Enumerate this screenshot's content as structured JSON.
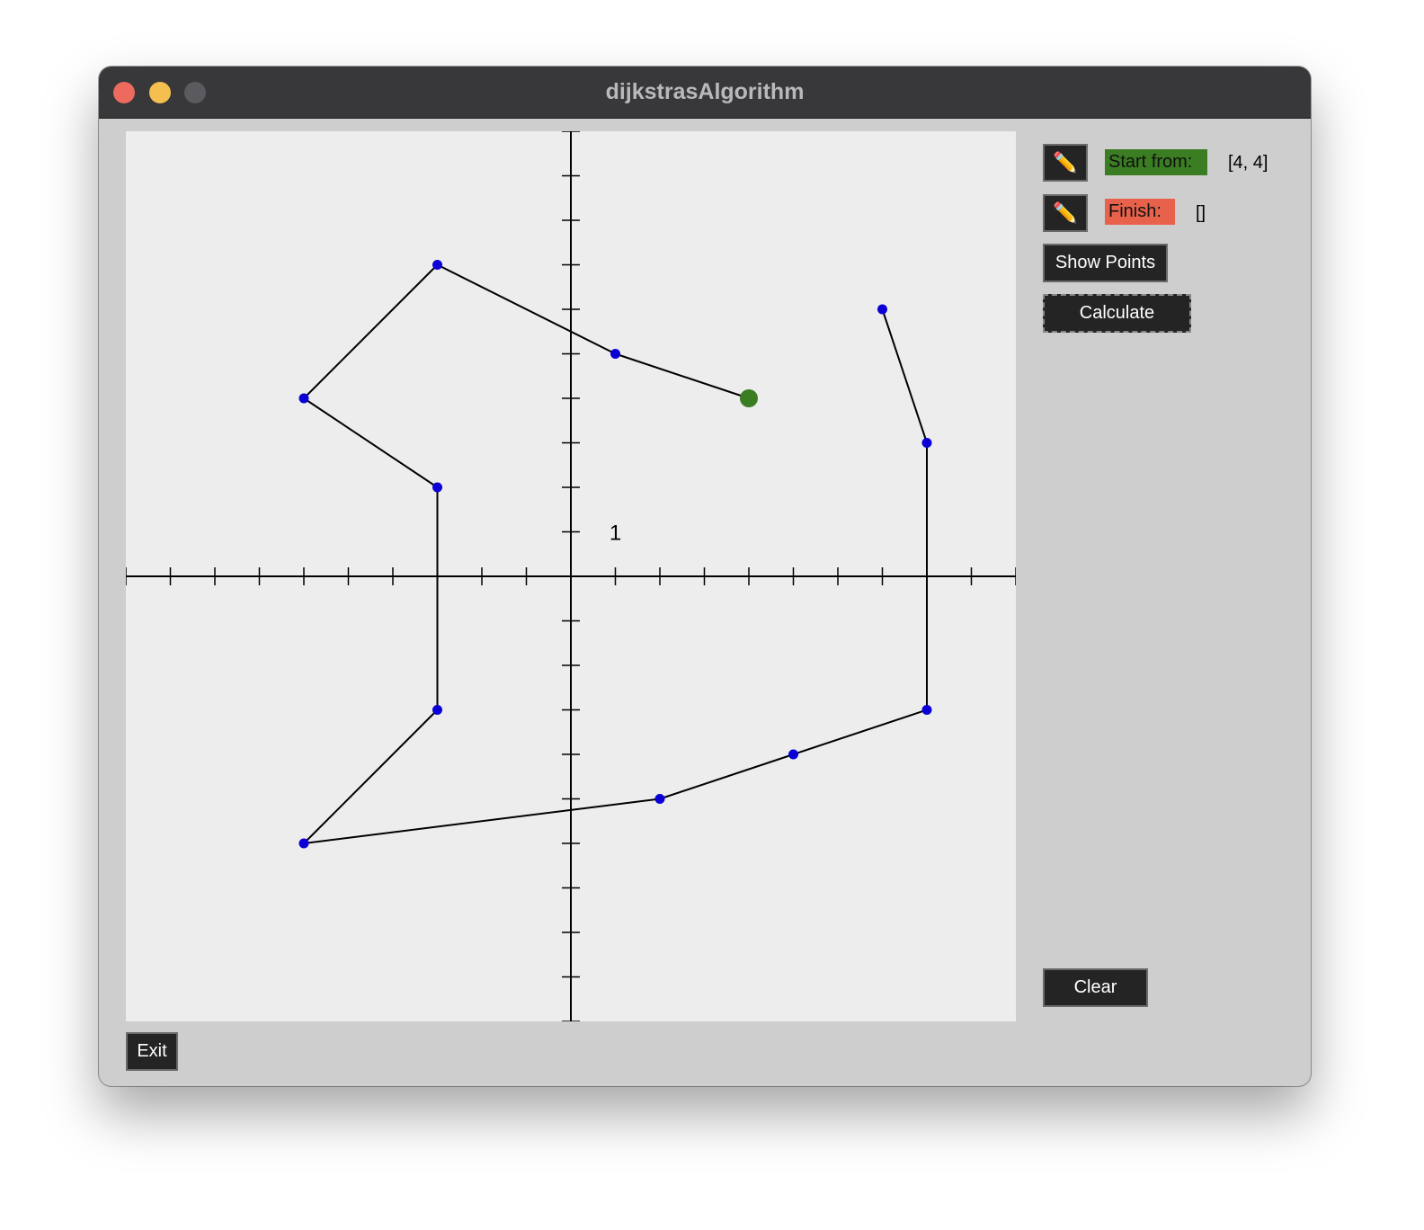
{
  "window": {
    "title": "dijkstrasAlgorithm"
  },
  "panel": {
    "start_label": "Start from:",
    "start_value": "[4, 4]",
    "finish_label": "Finish:",
    "finish_value": "[]",
    "show_points": "Show Points",
    "calculate": "Calculate",
    "clear": "Clear",
    "pencil_icon": "pencil-icon",
    "pencil_glyph": "✏️",
    "start_color": "#3a7d22",
    "finish_color": "#e8624b"
  },
  "footer": {
    "exit": "Exit"
  },
  "graph": {
    "axis_label": "1",
    "x_range": [
      -10,
      10
    ],
    "y_range": [
      -10,
      10
    ],
    "point_color": "#0a00d6",
    "start_point_color": "#3a7d22",
    "start_point": [
      4,
      4
    ],
    "paths": [
      [
        [
          1,
          5
        ],
        [
          -3,
          7
        ],
        [
          -6,
          4
        ],
        [
          -3,
          2
        ],
        [
          -3,
          -3
        ],
        [
          -6,
          -6
        ],
        [
          2,
          -5
        ],
        [
          5,
          -4
        ],
        [
          8,
          -3
        ],
        [
          8,
          3
        ],
        [
          7,
          6
        ]
      ],
      [
        [
          1,
          5
        ],
        [
          4,
          4
        ]
      ]
    ]
  }
}
